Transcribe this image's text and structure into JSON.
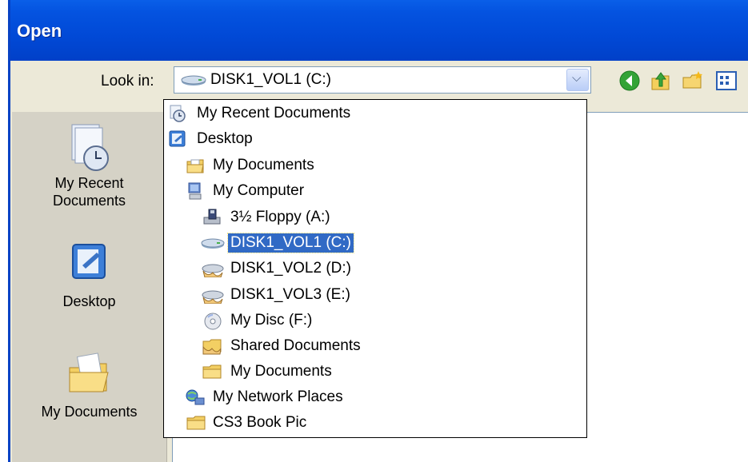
{
  "dialog": {
    "title": "Open"
  },
  "lookin": {
    "label": "Look in:",
    "selected_value": "DISK1_VOL1 (C:)"
  },
  "toolbar": {
    "back_icon": "back-arrow-icon",
    "up_icon": "up-folder-icon",
    "new_folder_icon": "new-folder-icon",
    "views_icon": "views-menu-icon"
  },
  "places": [
    {
      "label": "My Recent Documents",
      "line1": "My Recent",
      "line2": "Documents",
      "icon": "recent-documents-icon"
    },
    {
      "label": "Desktop",
      "icon": "desktop-icon"
    },
    {
      "label": "My Documents",
      "icon": "my-documents-icon"
    }
  ],
  "dropdown_items": [
    {
      "label": "My Recent Documents",
      "icon": "recent-documents-icon",
      "level": 0
    },
    {
      "label": "Desktop",
      "icon": "desktop-icon",
      "level": 0
    },
    {
      "label": "My Documents",
      "icon": "my-documents-icon",
      "level": 1
    },
    {
      "label": "My Computer",
      "icon": "my-computer-icon",
      "level": 1
    },
    {
      "label": "3½ Floppy (A:)",
      "icon": "floppy-drive-icon",
      "level": 2
    },
    {
      "label": "DISK1_VOL1 (C:)",
      "icon": "hard-drive-icon",
      "level": 2,
      "selected": true
    },
    {
      "label": "DISK1_VOL2 (D:)",
      "icon": "shared-drive-icon",
      "level": 2
    },
    {
      "label": "DISK1_VOL3 (E:)",
      "icon": "shared-drive-icon",
      "level": 2
    },
    {
      "label": "My Disc (F:)",
      "icon": "cd-drive-icon",
      "level": 2
    },
    {
      "label": "Shared Documents",
      "icon": "shared-folder-icon",
      "level": 2
    },
    {
      "label": "My Documents",
      "icon": "folder-icon",
      "level": 2
    },
    {
      "label": "My Network Places",
      "icon": "network-places-icon",
      "level": 1
    },
    {
      "label": "CS3 Book Pic",
      "icon": "folder-icon",
      "level": 1
    }
  ],
  "colors": {
    "titlebar": "#0149d6",
    "selection": "#316ac5",
    "dialog_bg": "#ece9d8"
  }
}
